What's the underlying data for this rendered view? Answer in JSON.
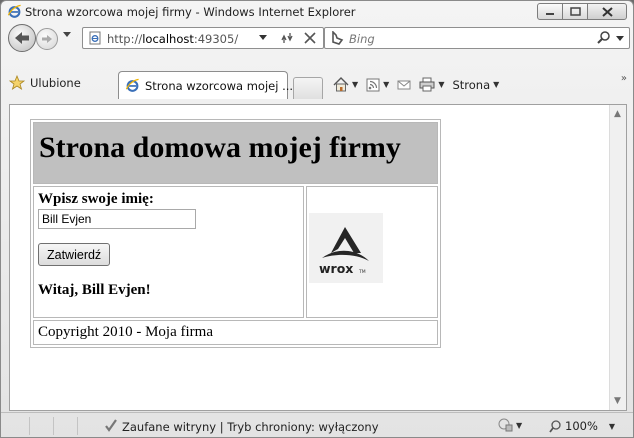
{
  "window": {
    "title": "Strona wzorcowa mojej firmy - Windows Internet Explorer"
  },
  "navigation": {
    "address_prefix": "http://",
    "address_host": "localhost",
    "address_rest": ":49305/",
    "search_placeholder": "Bing"
  },
  "favorites_bar": {
    "favorites_label": "Ulubione",
    "tab_title": "Strona wzorcowa mojej ...",
    "page_menu_label": "Strona"
  },
  "page": {
    "heading": "Strona domowa mojej firmy",
    "name_label": "Wpisz swoje imię:",
    "name_value": "Bill Evjen",
    "submit_label": "Zatwierdź",
    "greeting": "Witaj, Bill Evjen!",
    "logo_text": "wrox",
    "logo_tm": "TM",
    "footer": "Copyright 2010 - Moja firma"
  },
  "status_bar": {
    "text": "Zaufane witryny | Tryb chroniony: wyłączony",
    "zoom": "100%"
  },
  "icons": {
    "ie": "ie-icon",
    "back": "back-arrow-icon",
    "forward": "forward-arrow-icon",
    "page": "page-icon",
    "refresh": "refresh-icon",
    "stop": "stop-icon",
    "bing": "bing-icon",
    "search": "search-icon",
    "favorites": "star-icon",
    "home": "home-icon",
    "feeds": "rss-icon",
    "mail": "mail-icon",
    "print": "print-icon",
    "check": "checkmark-icon",
    "zoom": "magnifier-icon"
  }
}
